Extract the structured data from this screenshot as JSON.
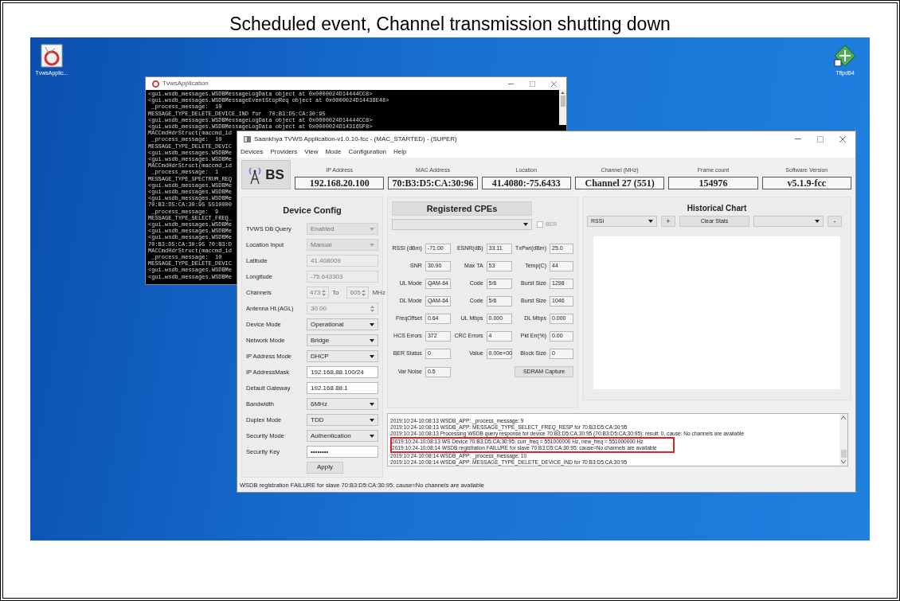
{
  "slide_title": "Scheduled event, Channel transmission shutting down",
  "desktop_icons": [
    {
      "label": "TvwsApplic...",
      "kind": "app"
    },
    {
      "label": "Tftpd64",
      "kind": "tftp"
    }
  ],
  "console_window": {
    "title": "TvwsApplication",
    "lines": [
      "<gui.wsdb_messages.WSDBMessageLogData object at 0x0000024D14444CC8>",
      "<gui.wsdb_messages.WSDBMessageEventStopReq object at 0x0000024D14438E48>",
      " _process_message:  10",
      "MESSAGE_TYPE_DELETE_DEVICE_IND for  70:B3:D5:CA:30:95",
      "<gui.wsdb_messages.WSDBMessageLogData object at 0x0000024D14444CC8>",
      "<gui.wsdb_messages.WSDBMessageLogData object at 0x0000024D143165F8>",
      "MACCmdHdrStruct(maccmd_id",
      " _process_message:  10",
      "MESSAGE_TYPE_DELETE_DEVIC",
      "<gui.wsdb_messages.WSDBMe",
      "<gui.wsdb_messages.WSDBMe",
      "MACCmdHdrStruct(maccmd_id",
      " _process_message:  1",
      "MESSAGE_TYPE_SPECTRUM_REQ",
      "<gui.wsdb_messages.WSDBMe",
      "<gui.wsdb_messages.WSDBMe",
      "<gui.wsdb_messages.WSDBMe",
      "70:B3:D5:CA:30:95 5510000",
      " _process_message:  9",
      "MESSAGE_TYPE_SELECT_FREQ_",
      "<gui.wsdb_messages.WSDBMe",
      "<gui.wsdb_messages.WSDBMe",
      "<gui.wsdb_messages.WSDBMe",
      "70:B3:D5:CA:30:95 70:B3:D",
      "MACCmdHdrStruct(maccmd_id",
      " _process_message:  10",
      "MESSAGE_TYPE_DELETE_DEVIC",
      "<gui.wsdb_messages.WSDBMe",
      "<gui.wsdb_messages.WSDBMe"
    ]
  },
  "main_window": {
    "title": "Saankhya TVWS Application-v1.0.10-fcc - (MAC_STARTED) - (SUPER)",
    "menu": [
      "Devices",
      "Providers",
      "View",
      "Mode",
      "Configuration",
      "Help"
    ],
    "logo_text": "BS",
    "header_fields": [
      {
        "label": "IP Address",
        "value": "192.168.20.100"
      },
      {
        "label": "MAC Address",
        "value": "70:B3:D5:CA:30:96"
      },
      {
        "label": "Location",
        "value": "41.4080:-75.6433"
      },
      {
        "label": "Channel (MHz)",
        "value": "Channel 27 (551)"
      },
      {
        "label": "Frame count",
        "value": "154976"
      },
      {
        "label": "Software Version",
        "value": "v5.1.9-fcc"
      }
    ],
    "device_config": {
      "title": "Device Config",
      "rows": [
        {
          "label": "TVWS DB Query",
          "kind": "select",
          "value": "Enabled",
          "disabled": true
        },
        {
          "label": "Location Input",
          "kind": "select",
          "value": "Manual",
          "disabled": true
        },
        {
          "label": "Latitude",
          "kind": "field",
          "value": "41.408009",
          "disabled": true
        },
        {
          "label": "Longitude",
          "kind": "field",
          "value": "-75.643303",
          "disabled": true
        },
        {
          "label": "Channels",
          "kind": "range",
          "value": "473",
          "separator": "To",
          "to": "605",
          "unit": "MHz",
          "disabled": true
        },
        {
          "label": "Antenna Ht.(AGL)",
          "kind": "spin",
          "value": "30.00",
          "disabled": true
        },
        {
          "label": "Device Mode",
          "kind": "select",
          "value": "Operational",
          "disabled": false
        },
        {
          "label": "Network Mode",
          "kind": "select",
          "value": "Bridge",
          "disabled": false
        },
        {
          "label": "IP Address Mode",
          "kind": "select",
          "value": "DHCP",
          "disabled": false
        },
        {
          "label": "IP AddressMask",
          "kind": "field",
          "value": "192.168.88.100/24",
          "disabled": false
        },
        {
          "label": "Default Gateway",
          "kind": "field",
          "value": "192.168.88.1",
          "disabled": false
        },
        {
          "label": "Bandwidth",
          "kind": "select",
          "value": "6MHz",
          "disabled": false
        },
        {
          "label": "Duplex Mode",
          "kind": "select",
          "value": "TDD",
          "disabled": false
        },
        {
          "label": "Security Mode",
          "kind": "select",
          "value": "Authentication",
          "disabled": false
        },
        {
          "label": "Security Key",
          "kind": "field",
          "value": "••••••••",
          "disabled": false
        }
      ],
      "apply_button": "Apply"
    },
    "cpes": {
      "title": "Registered CPEs",
      "ber_checkbox": {
        "label": "BER",
        "checked": false
      },
      "metrics": [
        [
          {
            "label": "RSSI (dBm)",
            "value": "-71.00"
          },
          {
            "label": "ESNR(dB)",
            "value": "33.11"
          },
          {
            "label": "TxPwr(dBm)",
            "value": "25.0"
          }
        ],
        [
          {
            "label": "SNR",
            "value": "30.90"
          },
          {
            "label": "Max TA",
            "value": "53"
          },
          {
            "label": "Temp(C)",
            "value": "44"
          }
        ],
        [
          {
            "label": "UL Mode",
            "value": "QAM-64"
          },
          {
            "label": "Code",
            "value": "5/6"
          },
          {
            "label": "Burst Size",
            "value": "1298"
          }
        ],
        [
          {
            "label": "DL Mode",
            "value": "QAM-64"
          },
          {
            "label": "Code",
            "value": "5/6"
          },
          {
            "label": "Burst Size",
            "value": "1046"
          }
        ],
        [
          {
            "label": "FreqOffset",
            "value": "0.64"
          },
          {
            "label": "UL Mbps",
            "value": "0.000"
          },
          {
            "label": "DL Mbps",
            "value": "0.000"
          }
        ],
        [
          {
            "label": "HCS Errors",
            "value": "372"
          },
          {
            "label": "CRC Errors",
            "value": "4"
          },
          {
            "label": "Pkt Err(%)",
            "value": "0.00"
          }
        ],
        [
          {
            "label": "BER Status",
            "value": "0"
          },
          {
            "label": "Value",
            "value": "0.00e+00"
          },
          {
            "label": "Block Size",
            "value": "0"
          }
        ]
      ],
      "var_noise": {
        "label": "Var Noise",
        "value": "0.5"
      },
      "sdram_button": "SDRAM Capture"
    },
    "historical_chart": {
      "title": "Historical Chart",
      "metric_select": "RSSI",
      "add_button": "+",
      "clear_button": "Clear Stats",
      "remove_button": "-"
    },
    "log_lines": [
      {
        "text": "2019:10:24-10:08:13 WSDB_APP: _process_message:  9",
        "highlighted": false
      },
      {
        "text": "2019:10:24-10:08:13 WSDB_APP: MESSAGE_TYPE_SELECT_FREQ_RESP for  70:B3:D5:CA:30:95",
        "highlighted": false
      },
      {
        "text": "2019:10:24-10:08:13 Processing WSDB query response for device 70:B3:D5:CA:30:95 (70:B3:D5:CA:30:95): result: 0, cause: No channels are available",
        "highlighted": false
      },
      {
        "text": "2019:10:24-10:08:13 WS Device 70:B3:D5:CA:30:95: curr_freq = 551000000 Hz, new_freq = 551000000 Hz",
        "highlighted": true
      },
      {
        "text": "2019:10:24-10:08:14 WSDB registration FAILURE for slave 70:B3:D5:CA:30:95: cause=No channels are available",
        "highlighted": true
      },
      {
        "text": "2019:10:24-10:08:14 WSDB_APP: _process_message:  10",
        "highlighted": false
      },
      {
        "text": "2019:10:24-10:08:14 WSDB_APP: MESSAGE_TYPE_DELETE_DEVICE_IND for  70:B3:D5:CA:30:95",
        "highlighted": false
      }
    ],
    "status_bar": "WSDB registration FAILURE for slave 70:B3:D5:CA:30:95: cause=No channels are available"
  }
}
